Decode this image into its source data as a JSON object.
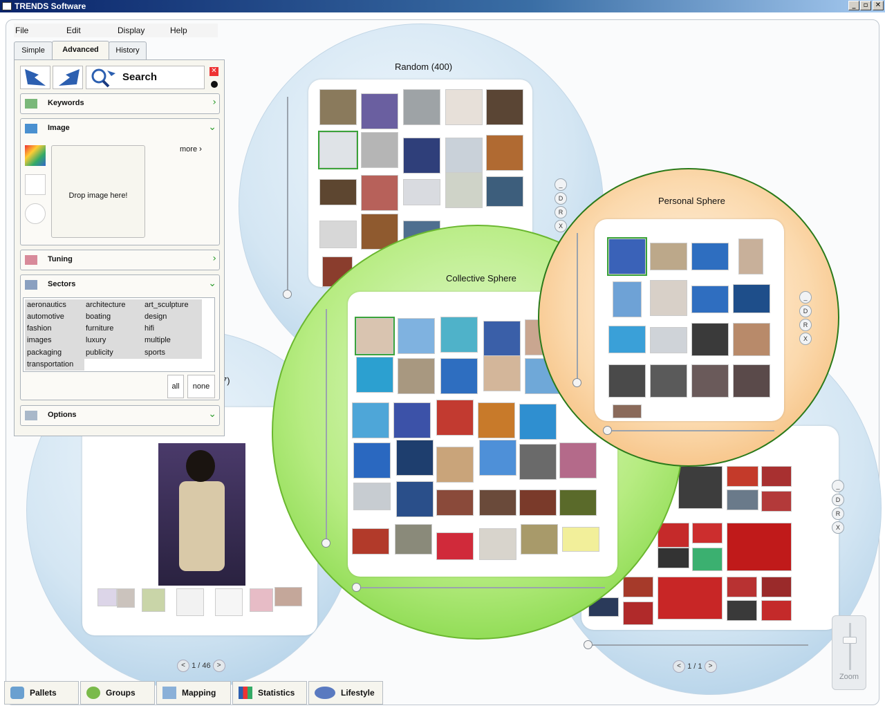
{
  "window": {
    "title": "TRENDS Software",
    "buttons": [
      "_",
      "▫",
      "✕"
    ]
  },
  "menu": [
    "File",
    "Edit",
    "Display",
    "Help"
  ],
  "tabs": [
    {
      "label": "Simple",
      "active": false
    },
    {
      "label": "Advanced",
      "active": true
    },
    {
      "label": "History",
      "active": false
    }
  ],
  "search": {
    "label": "Search"
  },
  "sections": {
    "keywords": "Keywords",
    "image": "Image",
    "tuning": "Tuning",
    "sectors": "Sectors",
    "options": "Options"
  },
  "image_panel": {
    "more": "more",
    "drop": "Drop image here!"
  },
  "sectors": [
    "aeronautics",
    "architecture",
    "art_sculpture",
    "automotive",
    "boating",
    "design",
    "fashion",
    "furniture",
    "hifi",
    "images",
    "luxury",
    "multiple",
    "packaging",
    "publicity",
    "sports",
    "transportation"
  ],
  "sector_buttons": {
    "all": "all",
    "none": "none"
  },
  "spheres": {
    "random": {
      "title": "Random (400)"
    },
    "collective": {
      "title": "Collective Sphere"
    },
    "personal": {
      "title": "Personal Sphere"
    },
    "left_partial": {
      "title_fragment": "7)"
    }
  },
  "sphere_controls": [
    "_",
    "D",
    "R",
    "X"
  ],
  "pagers": {
    "left": {
      "text": "1 / 46",
      "prev": "<",
      "next": ">"
    },
    "right": {
      "text": "1 / 1",
      "prev": "<",
      "next": ">"
    }
  },
  "bottom_tabs": [
    "Pallets",
    "Groups",
    "Mapping",
    "Statistics",
    "Lifestyle"
  ],
  "zoom": {
    "label": "Zoom"
  },
  "colors": {
    "titlebar": "#0a246a",
    "green_sphere": "#86d849",
    "orange_sphere": "#f5bd7b",
    "blue_sphere": "#b9d5ea",
    "accent_arrow": "#2c9c2c"
  }
}
